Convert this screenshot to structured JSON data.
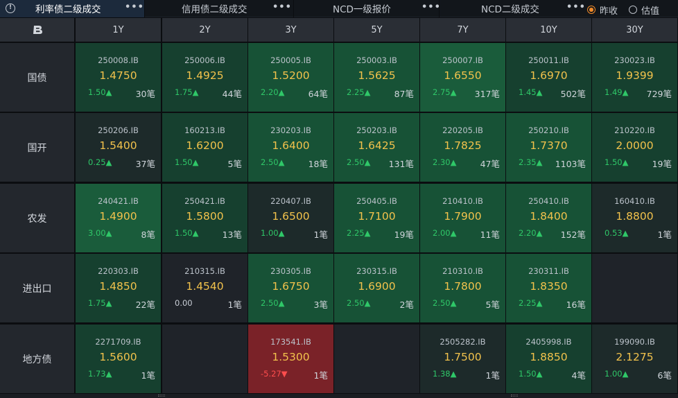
{
  "tabs": [
    {
      "label": "利率债二级成交",
      "more": "•••"
    },
    {
      "label": "信用债二级成交",
      "more": "•••"
    },
    {
      "label": "NCD一级报价",
      "more": "•••"
    },
    {
      "label": "NCD二级成交",
      "more": "•••"
    }
  ],
  "radio": {
    "option1": "昨收",
    "option2": "估值"
  },
  "columns": [
    "1Y",
    "2Y",
    "3Y",
    "5Y",
    "7Y",
    "10Y",
    "30Y"
  ],
  "rows": [
    {
      "label": "国债",
      "cells": [
        {
          "code": "250008.IB",
          "price": "1.4750",
          "chg": "1.50▲",
          "dir": "up",
          "count": "30笔",
          "shade": "g1"
        },
        {
          "code": "250006.IB",
          "price": "1.4925",
          "chg": "1.75▲",
          "dir": "up",
          "count": "44笔",
          "shade": "g1"
        },
        {
          "code": "250005.IB",
          "price": "1.5200",
          "chg": "2.20▲",
          "dir": "up",
          "count": "64笔",
          "shade": "g2"
        },
        {
          "code": "250003.IB",
          "price": "1.5625",
          "chg": "2.25▲",
          "dir": "up",
          "count": "87笔",
          "shade": "g2"
        },
        {
          "code": "250007.IB",
          "price": "1.6550",
          "chg": "2.75▲",
          "dir": "up",
          "count": "317笔",
          "shade": "g3"
        },
        {
          "code": "250011.IB",
          "price": "1.6970",
          "chg": "1.45▲",
          "dir": "up",
          "count": "502笔",
          "shade": "g1"
        },
        {
          "code": "230023.IB",
          "price": "1.9399",
          "chg": "1.49▲",
          "dir": "up",
          "count": "729笔",
          "shade": "g1"
        }
      ]
    },
    {
      "label": "国开",
      "cells": [
        {
          "code": "250206.IB",
          "price": "1.5400",
          "chg": "0.25▲",
          "dir": "up",
          "count": "37笔",
          "shade": "g0"
        },
        {
          "code": "160213.IB",
          "price": "1.6200",
          "chg": "1.50▲",
          "dir": "up",
          "count": "5笔",
          "shade": "g1"
        },
        {
          "code": "230203.IB",
          "price": "1.6400",
          "chg": "2.50▲",
          "dir": "up",
          "count": "18笔",
          "shade": "g2"
        },
        {
          "code": "250203.IB",
          "price": "1.6425",
          "chg": "2.50▲",
          "dir": "up",
          "count": "131笔",
          "shade": "g2"
        },
        {
          "code": "220205.IB",
          "price": "1.7825",
          "chg": "2.30▲",
          "dir": "up",
          "count": "47笔",
          "shade": "g2"
        },
        {
          "code": "250210.IB",
          "price": "1.7370",
          "chg": "2.35▲",
          "dir": "up",
          "count": "1103笔",
          "shade": "g2"
        },
        {
          "code": "210220.IB",
          "price": "2.0000",
          "chg": "1.50▲",
          "dir": "up",
          "count": "19笔",
          "shade": "g1"
        }
      ]
    },
    {
      "label": "农发",
      "cells": [
        {
          "code": "240421.IB",
          "price": "1.4900",
          "chg": "3.00▲",
          "dir": "up",
          "count": "8笔",
          "shade": "g3"
        },
        {
          "code": "250421.IB",
          "price": "1.5800",
          "chg": "1.50▲",
          "dir": "up",
          "count": "13笔",
          "shade": "g1"
        },
        {
          "code": "220407.IB",
          "price": "1.6500",
          "chg": "1.00▲",
          "dir": "up",
          "count": "1笔",
          "shade": "g0"
        },
        {
          "code": "250405.IB",
          "price": "1.7100",
          "chg": "2.25▲",
          "dir": "up",
          "count": "19笔",
          "shade": "g2"
        },
        {
          "code": "210410.IB",
          "price": "1.7900",
          "chg": "2.00▲",
          "dir": "up",
          "count": "11笔",
          "shade": "g2"
        },
        {
          "code": "250410.IB",
          "price": "1.8400",
          "chg": "2.20▲",
          "dir": "up",
          "count": "152笔",
          "shade": "g2"
        },
        {
          "code": "160410.IB",
          "price": "1.8800",
          "chg": "0.53▲",
          "dir": "up",
          "count": "1笔",
          "shade": "g0"
        }
      ]
    },
    {
      "label": "进出口",
      "cells": [
        {
          "code": "220303.IB",
          "price": "1.4850",
          "chg": "1.75▲",
          "dir": "up",
          "count": "22笔",
          "shade": "g1"
        },
        {
          "code": "210315.IB",
          "price": "1.4540",
          "chg": "0.00",
          "dir": "flat",
          "count": "1笔",
          "shade": "empty"
        },
        {
          "code": "230305.IB",
          "price": "1.6750",
          "chg": "2.50▲",
          "dir": "up",
          "count": "3笔",
          "shade": "g2"
        },
        {
          "code": "230315.IB",
          "price": "1.6900",
          "chg": "2.50▲",
          "dir": "up",
          "count": "2笔",
          "shade": "g2"
        },
        {
          "code": "210310.IB",
          "price": "1.7800",
          "chg": "2.50▲",
          "dir": "up",
          "count": "5笔",
          "shade": "g2"
        },
        {
          "code": "230311.IB",
          "price": "1.8350",
          "chg": "2.25▲",
          "dir": "up",
          "count": "16笔",
          "shade": "g2"
        },
        null
      ]
    },
    {
      "label": "地方债",
      "cells": [
        {
          "code": "2271709.IB",
          "price": "1.5600",
          "chg": "1.73▲",
          "dir": "up",
          "count": "1笔",
          "shade": "g1"
        },
        null,
        {
          "code": "173541.IB",
          "price": "1.5300",
          "chg": "-5.27▼",
          "dir": "down",
          "count": "1笔",
          "shade": "red"
        },
        null,
        {
          "code": "2505282.IB",
          "price": "1.7500",
          "chg": "1.38▲",
          "dir": "up",
          "count": "1笔",
          "shade": "g0"
        },
        {
          "code": "2405998.IB",
          "price": "1.8850",
          "chg": "1.50▲",
          "dir": "up",
          "count": "4笔",
          "shade": "g1"
        },
        {
          "code": "199090.IB",
          "price": "2.1275",
          "chg": "1.00▲",
          "dir": "up",
          "count": "6笔",
          "shade": "g0"
        }
      ]
    }
  ]
}
